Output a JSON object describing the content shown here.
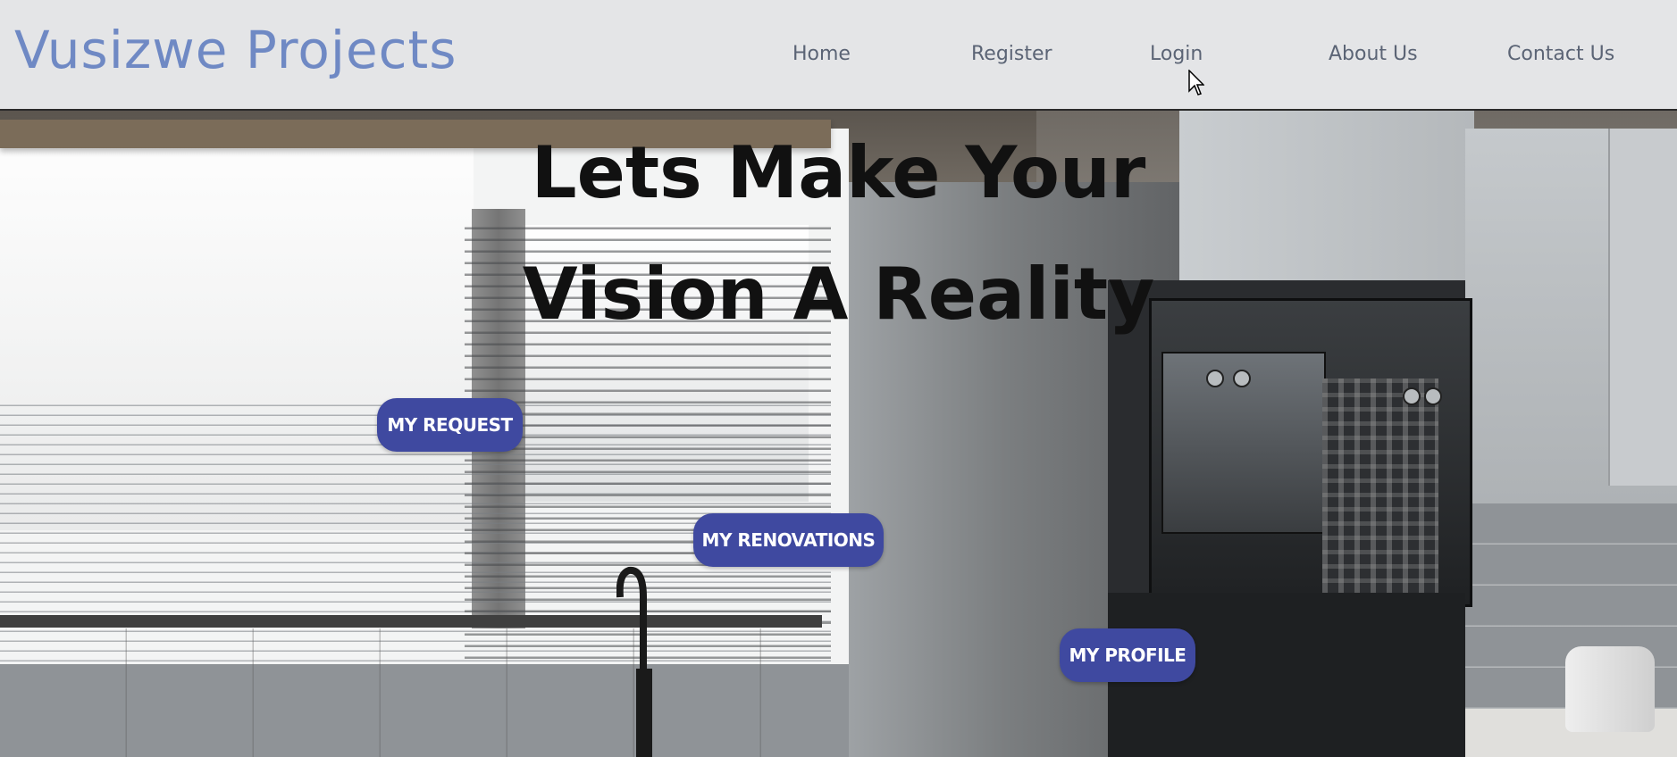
{
  "brand": "Vusizwe Projects",
  "nav": {
    "home": "Home",
    "register": "Register",
    "login": "Login",
    "about": "About Us",
    "contact": "Contact Us"
  },
  "hero": {
    "title_line1": "Lets Make Your",
    "title_line2": "Vision A Reality"
  },
  "buttons": {
    "my_request": "MY REQUEST",
    "my_renovations": "MY RENOVATIONS",
    "my_profile": "MY PROFILE"
  },
  "colors": {
    "brand": "#6f89c4",
    "nav_text": "#5b6475",
    "header_bg": "#e4e5e7",
    "button_bg": "#3f49a0",
    "button_text": "#ffffff"
  }
}
